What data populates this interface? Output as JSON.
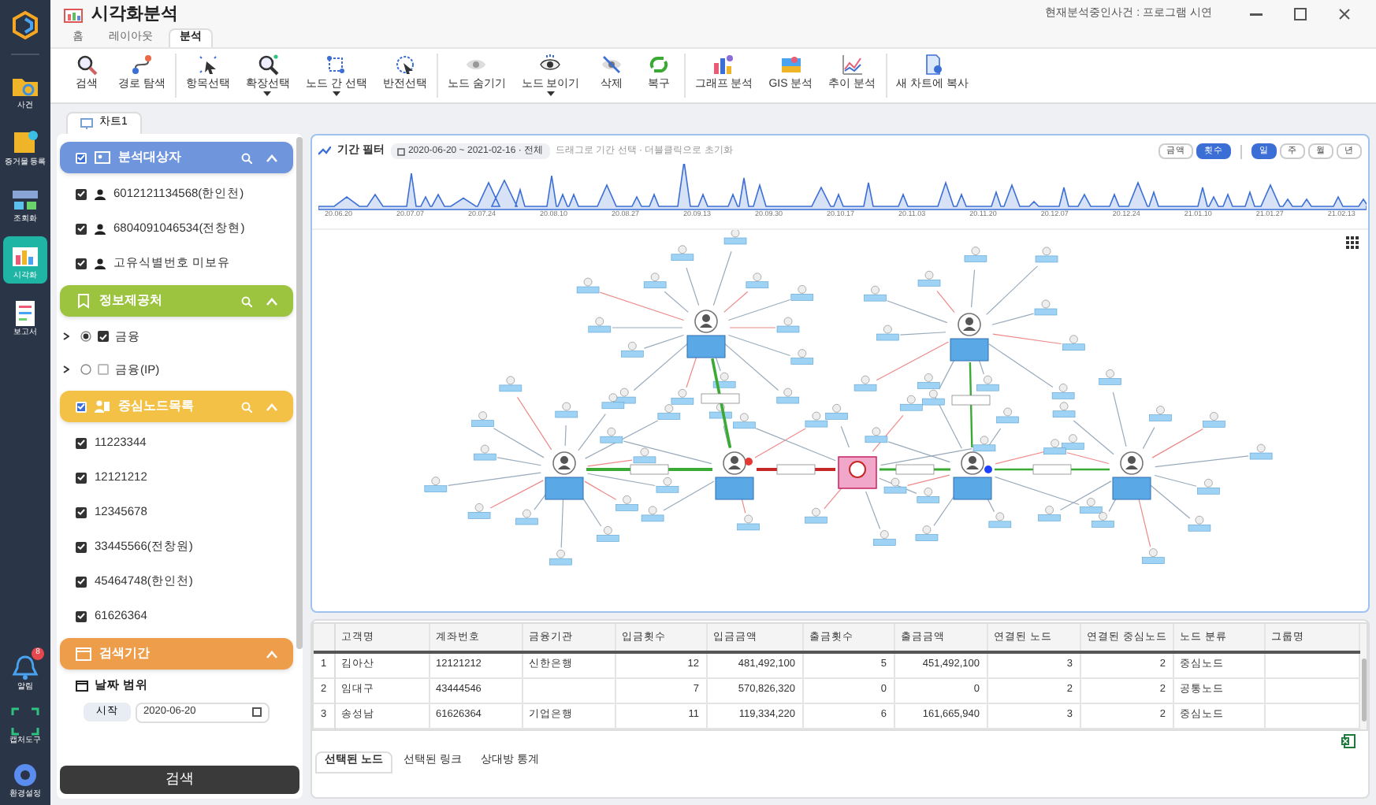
{
  "app": {
    "title": "시각화분석",
    "session": "현재분석중인사건 : 프로그램 시연"
  },
  "nav_rail": {
    "items": [
      {
        "label": "사건",
        "selected": false
      },
      {
        "label": "증거물 등록",
        "selected": false
      },
      {
        "label": "조회화",
        "selected": false
      },
      {
        "label": "시각화",
        "selected": true
      },
      {
        "label": "보고서",
        "selected": false
      }
    ],
    "bottom": [
      {
        "label": "알림",
        "badge": "8"
      },
      {
        "label": "캡처도구"
      },
      {
        "label": "환경설정"
      }
    ]
  },
  "menu_tabs": [
    {
      "label": "홈",
      "selected": false
    },
    {
      "label": "레이아웃",
      "selected": false
    },
    {
      "label": "분석",
      "selected": true
    }
  ],
  "toolbar": {
    "groups": [
      [
        {
          "label": "검색",
          "dropdown": false
        },
        {
          "label": "경로 탐색",
          "dropdown": false
        }
      ],
      [
        {
          "label": "항목선택",
          "dropdown": false
        },
        {
          "label": "확장선택",
          "dropdown": true
        },
        {
          "label": "노드 간 선택",
          "dropdown": true
        },
        {
          "label": "반전선택",
          "dropdown": false
        }
      ],
      [
        {
          "label": "노드 숨기기",
          "dropdown": false
        },
        {
          "label": "노드 보이기",
          "dropdown": true
        },
        {
          "label": "삭제",
          "dropdown": false
        },
        {
          "label": "복구",
          "dropdown": false
        }
      ],
      [
        {
          "label": "그래프 분석",
          "dropdown": false
        },
        {
          "label": "GIS 분석",
          "dropdown": false
        },
        {
          "label": "추이 분석",
          "dropdown": false
        }
      ],
      [
        {
          "label": "새 차트에 복사",
          "dropdown": false
        }
      ]
    ]
  },
  "chart_tabs": [
    {
      "label": "차트1",
      "selected": true
    }
  ],
  "side_panel": {
    "sections": [
      {
        "kind": "list",
        "title": "분석대상자",
        "color": "#6f95dc",
        "checked": true,
        "items": [
          {
            "label": "6012121134568(한인천)",
            "checked": true
          },
          {
            "label": "6804091046534(전창현)",
            "checked": true
          },
          {
            "label": "고유식별번호 미보유",
            "checked": true
          }
        ]
      },
      {
        "kind": "tree",
        "title": "정보제공처",
        "color": "#9cc43f",
        "items": [
          {
            "label": "금융",
            "selected": true,
            "checked": true
          },
          {
            "label": "금융(IP)",
            "selected": false,
            "checked": false
          }
        ]
      },
      {
        "kind": "plain",
        "title": "중심노드목록",
        "color": "#f3c145",
        "checked": true,
        "items": [
          {
            "label": "11223344",
            "checked": true
          },
          {
            "label": "12121212",
            "checked": true
          },
          {
            "label": "12345678",
            "checked": true
          },
          {
            "label": "33445566(전창원)",
            "checked": true
          },
          {
            "label": "45464748(한인천)",
            "checked": true
          },
          {
            "label": "61626364",
            "checked": true
          }
        ]
      },
      {
        "kind": "date",
        "title": "검색기간",
        "color": "#ee9e4a",
        "range_label": "날짜 범위",
        "start_label": "시작",
        "start_value": "2020-06-20"
      }
    ],
    "search_button": "검색"
  },
  "graph_panel": {
    "filter_title": "기간 필터",
    "range": "2020-06-20 ~ 2021-02-16 · 전체",
    "hint": "드래그로 기간 선택 · 더블클릭으로 초기화",
    "metric_toggles": [
      {
        "label": "금액",
        "selected": false
      },
      {
        "label": "횟수",
        "selected": true
      }
    ],
    "period_toggles": [
      {
        "label": "일",
        "selected": true
      },
      {
        "label": "주",
        "selected": false
      },
      {
        "label": "월",
        "selected": false
      },
      {
        "label": "년",
        "selected": false
      }
    ],
    "timeline_labels": [
      "20.06.20",
      "20.07.07",
      "20.07.24",
      "20.08.10",
      "20.08.27",
      "20.09.13",
      "20.09.30",
      "20.10.17",
      "20.11.03",
      "20.11.20",
      "20.12.07",
      "20.12.24",
      "21.01.10",
      "21.01.27",
      "21.02.13"
    ]
  },
  "table": {
    "columns": [
      "고객명",
      "계좌번호",
      "금융기관",
      "입금횟수",
      "입금금액",
      "출금횟수",
      "출금금액",
      "연결된 노드",
      "연결된 중심노드",
      "노드 분류",
      "그룹명"
    ],
    "rows": [
      {
        "number": "1",
        "cells": [
          "김아산",
          "12121212",
          "신한은행",
          "12",
          "481,492,100",
          "5",
          "451,492,100",
          "3",
          "2",
          "중심노드",
          ""
        ]
      },
      {
        "number": "2",
        "cells": [
          "임대구",
          "43444546",
          "",
          "7",
          "570,826,320",
          "0",
          "0",
          "2",
          "2",
          "공통노드",
          ""
        ]
      },
      {
        "number": "3",
        "cells": [
          "송성남",
          "61626364",
          "기업은행",
          "11",
          "119,334,220",
          "6",
          "161,665,940",
          "3",
          "2",
          "중심노드",
          ""
        ]
      }
    ]
  },
  "bottom_tabs": [
    {
      "label": "선택된 노드",
      "selected": true
    },
    {
      "label": "선택된 링크",
      "selected": false
    },
    {
      "label": "상대방 통계",
      "selected": false
    }
  ]
}
